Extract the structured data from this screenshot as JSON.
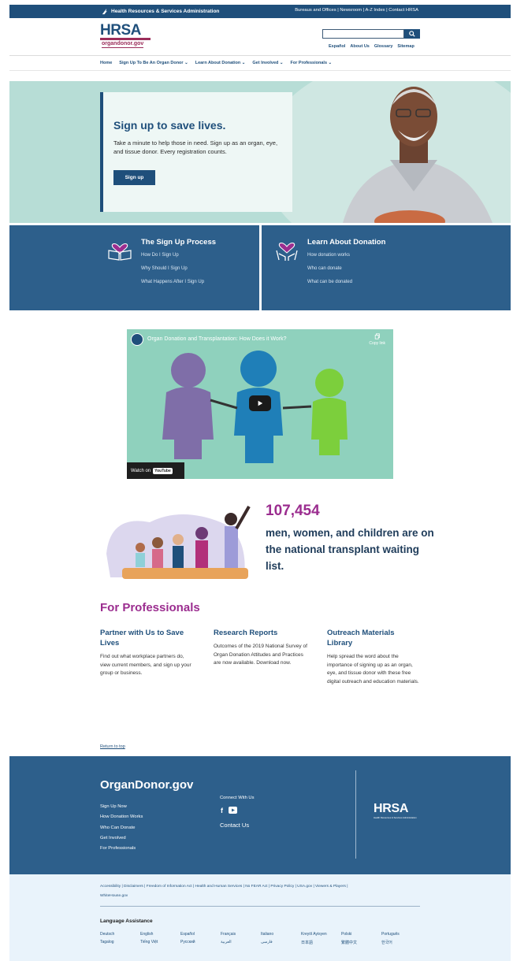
{
  "govbar": {
    "agency": "Health Resources & Services Administration",
    "links": "Bureaus and Offices | Newsroom | A-Z Index | Contact HRSA"
  },
  "header": {
    "logo": "HRSA",
    "logo_sub": "organdonor.gov",
    "search_placeholder": "",
    "util": [
      "Español",
      "About Us",
      "Glossary",
      "Sitemap"
    ]
  },
  "nav": [
    "Home",
    "Sign Up To Be An Organ Donor ⌄",
    "Learn About Donation ⌄",
    "Get Involved ⌄",
    "For Professionals ⌄"
  ],
  "hero": {
    "title": "Sign up to save lives.",
    "text": "Take a minute to help those in need. Sign up as an organ, eye, and tissue donor. Every registration counts.",
    "button": "Sign up"
  },
  "panels": [
    {
      "title": "The Sign Up Process",
      "links": [
        "How Do I Sign Up",
        "Why Should I Sign Up",
        "What Happens After I Sign Up"
      ]
    },
    {
      "title": "Learn About Donation",
      "links": [
        "How donation works",
        "Who can donate",
        "What can be donated"
      ]
    }
  ],
  "video": {
    "title": "Organ Donation and Transplantation: How Does it Work?",
    "copy_link": "Copy link",
    "watch_on": "Watch on",
    "youtube": "YouTube"
  },
  "stats": {
    "number": "107,454",
    "text": "men, women, and children are on the national transplant waiting list."
  },
  "professionals": {
    "title": "For Professionals",
    "columns": [
      {
        "title": "Partner with Us to Save Lives",
        "text": "Find out what workplace partners do, view current members, and sign up your group or business."
      },
      {
        "title": "Research Reports",
        "text": "Outcomes of the 2019 National Survey of Organ Donation Attitudes and Practices are now available. Download now."
      },
      {
        "title": "Outreach Materials Library",
        "text": "Help spread the word about the importance of signing up as an organ, eye, and tissue donor with these free digital outreach and education materials."
      }
    ]
  },
  "return_to_top": "Return to top",
  "footer": {
    "brand": "OrganDonor.gov",
    "links": [
      "Sign Up Now",
      "How Donation Works",
      "Who Can Donate",
      "Get Involved",
      "For Professionals"
    ],
    "connect": "Connect With Us",
    "contact": "Contact Us",
    "hrsa": "HRSA",
    "hrsa_sub": "Health Resources & Services Administration"
  },
  "legal": [
    "Accessibility",
    "Disclaimers",
    "Freedom of Information Act",
    "Health and Human Services",
    "No FEAR Act",
    "Privacy Policy",
    "USA.gov",
    "Viewers & Players",
    "WhiteHouse.gov"
  ],
  "language": {
    "title": "Language Assistance",
    "items": [
      "Deutsch",
      "English",
      "Español",
      "Français",
      "Italiano",
      "Kreyòl Ayisyen",
      "Polski",
      "Português",
      "Tagalog",
      "Tiếng Việt",
      "Русский",
      "العربية",
      "فارسی",
      "日本語",
      "繁體中文",
      "한국어"
    ]
  },
  "colors": {
    "navy": "#1f4f7b",
    "panel_blue": "#2d5f8b",
    "magenta": "#9b2d8f",
    "mint": "#b7ddd6"
  }
}
